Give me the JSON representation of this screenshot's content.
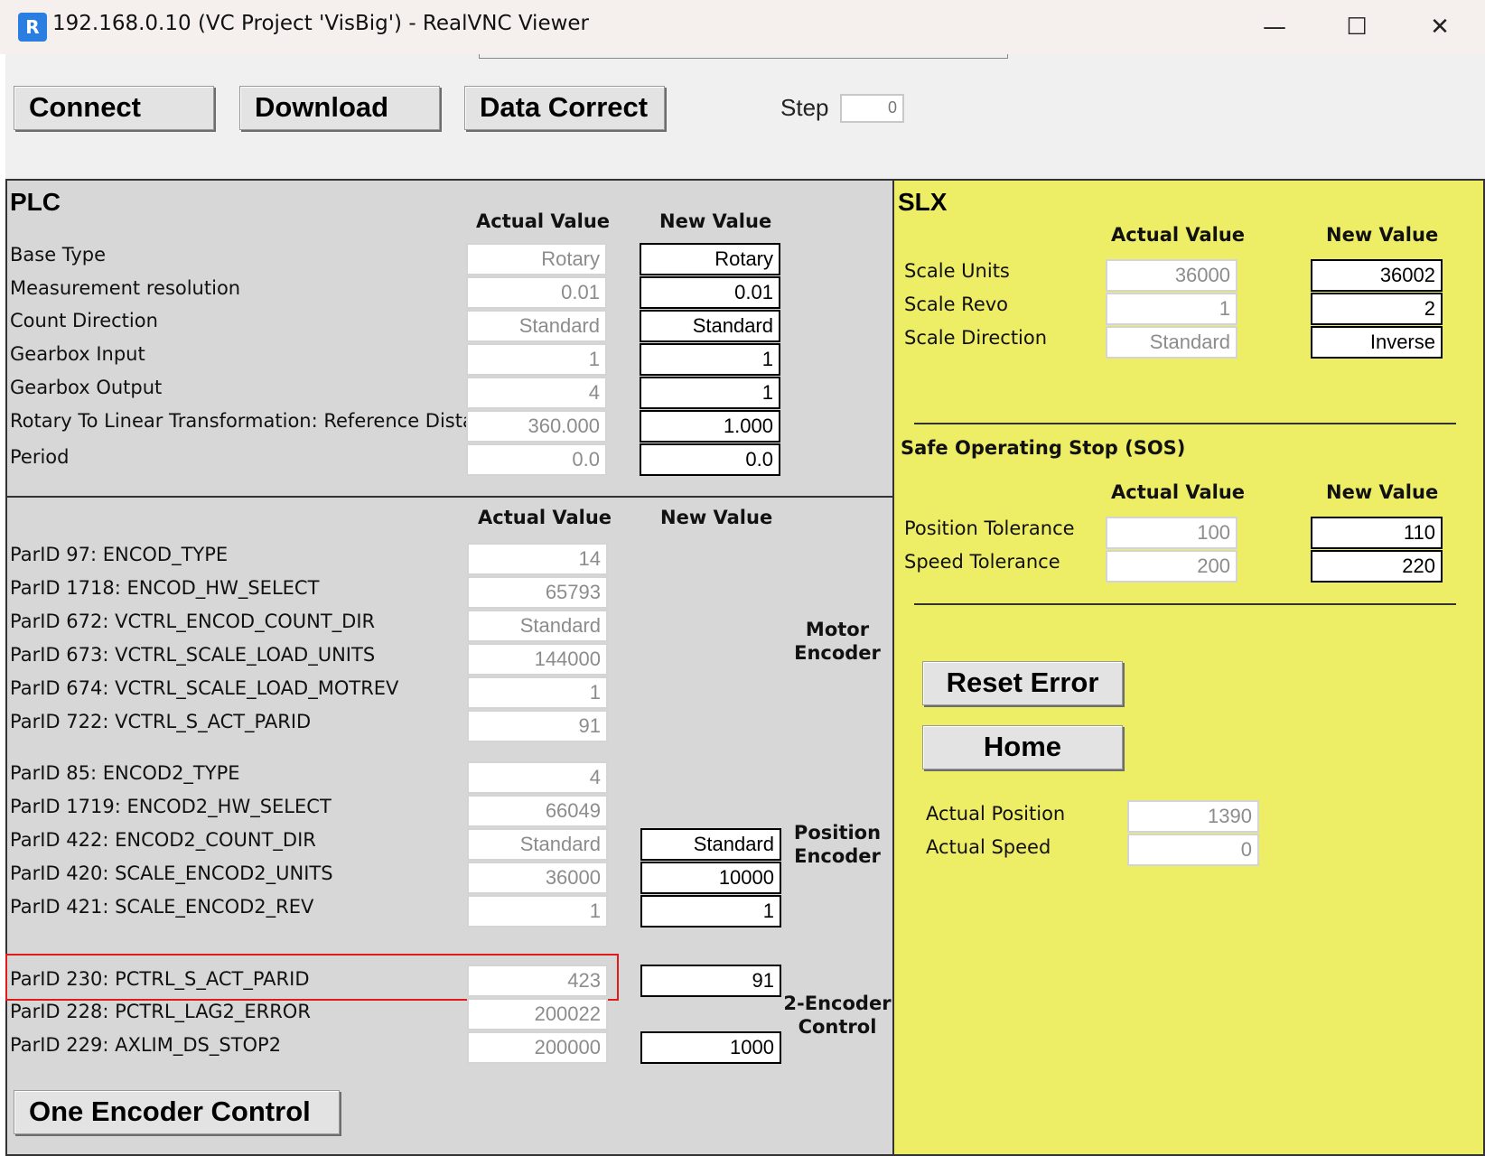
{
  "window": {
    "title": "192.168.0.10 (VC Project 'VisBig') - RealVNC Viewer",
    "minimize": "—",
    "maximize": "☐",
    "close": "✕",
    "icon": "realvnc-icon",
    "icon_glyph": "R"
  },
  "toolbar": {
    "connect": "Connect",
    "download": "Download",
    "data_correct": "Data Correct",
    "step_label": "Step",
    "step_value": "0"
  },
  "plc": {
    "title": "PLC",
    "actual_header": "Actual Value",
    "new_header": "New Value",
    "rows": [
      {
        "label": "Base Type",
        "actual": "Rotary",
        "new": "Rotary"
      },
      {
        "label": "Measurement resolution",
        "actual": "0.01",
        "new": "0.01"
      },
      {
        "label": "Count Direction",
        "actual": "Standard",
        "new": "Standard"
      },
      {
        "label": "Gearbox Input",
        "actual": "1",
        "new": "1"
      },
      {
        "label": "Gearbox Output",
        "actual": "4",
        "new": "1"
      },
      {
        "label": "Rotary To Linear Transformation: Reference Distance",
        "actual": "360.000",
        "new": "1.000"
      },
      {
        "label": "Period",
        "actual": "0.0",
        "new": "0.0"
      }
    ],
    "params_actual_header": "Actual Value",
    "params_new_header": "New Value",
    "motor_encoder": {
      "group_label_1": "Motor",
      "group_label_2": "Encoder",
      "rows": [
        {
          "label": "ParID 97: ENCOD_TYPE",
          "actual": "14"
        },
        {
          "label": "ParID 1718: ENCOD_HW_SELECT",
          "actual": "65793"
        },
        {
          "label": "ParID 672: VCTRL_ENCOD_COUNT_DIR",
          "actual": "Standard"
        },
        {
          "label": "ParID 673: VCTRL_SCALE_LOAD_UNITS",
          "actual": "144000"
        },
        {
          "label": "ParID 674: VCTRL_SCALE_LOAD_MOTREV",
          "actual": "1"
        },
        {
          "label": "ParID 722: VCTRL_S_ACT_PARID",
          "actual": "91"
        }
      ]
    },
    "position_encoder": {
      "group_label_1": "Position",
      "group_label_2": "Encoder",
      "rows": [
        {
          "label": "ParID 85: ENCOD2_TYPE",
          "actual": "4"
        },
        {
          "label": "ParID 1719: ENCOD2_HW_SELECT",
          "actual": "66049"
        },
        {
          "label": "ParID 422: ENCOD2_COUNT_DIR",
          "actual": "Standard",
          "new": "Standard"
        },
        {
          "label": "ParID 420: SCALE_ENCOD2_UNITS",
          "actual": "36000",
          "new": "10000"
        },
        {
          "label": "ParID 421: SCALE_ENCOD2_REV",
          "actual": "1",
          "new": "1"
        }
      ]
    },
    "two_encoder": {
      "group_label_1": "2-Encoder",
      "group_label_2": "Control",
      "rows": [
        {
          "label": "ParID 230: PCTRL_S_ACT_PARID",
          "actual": "423",
          "new": "91"
        },
        {
          "label": "ParID 228: PCTRL_LAG2_ERROR",
          "actual": "200022"
        },
        {
          "label": "ParID 229: AXLIM_DS_STOP2",
          "actual": "200000",
          "new": "1000"
        }
      ]
    },
    "one_encoder_button": "One Encoder Control"
  },
  "slx": {
    "title": "SLX",
    "actual_header": "Actual Value",
    "new_header": "New Value",
    "rows": [
      {
        "label": "Scale Units",
        "actual": "36000",
        "new": "36002"
      },
      {
        "label": "Scale Revo",
        "actual": "1",
        "new": "2"
      },
      {
        "label": "Scale Direction",
        "actual": "Standard",
        "new": "Inverse"
      }
    ],
    "sos_title": "Safe Operating Stop (SOS)",
    "sos_actual_header": "Actual Value",
    "sos_new_header": "New Value",
    "sos_rows": [
      {
        "label": "Position Tolerance",
        "actual": "100",
        "new": "110"
      },
      {
        "label": "Speed Tolerance",
        "actual": "200",
        "new": "220"
      }
    ],
    "reset_error": "Reset Error",
    "home": "Home",
    "status": [
      {
        "label": "Actual Position",
        "value": "1390"
      },
      {
        "label": "Actual Speed",
        "value": "0"
      }
    ]
  },
  "colors": {
    "slx_background": "#eeed66",
    "plc_background": "#d7d7d7",
    "highlight": "#e01b1b"
  }
}
